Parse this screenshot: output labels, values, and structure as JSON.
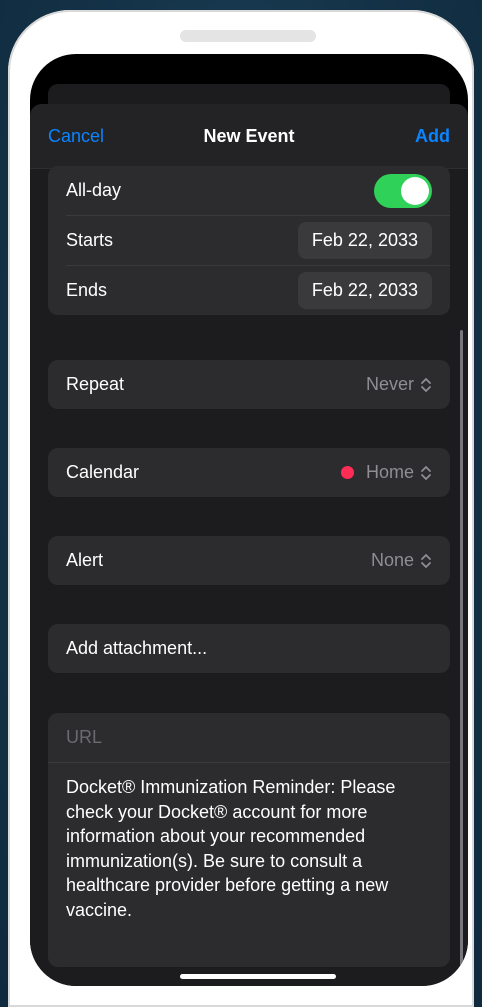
{
  "nav": {
    "cancel": "Cancel",
    "title": "New Event",
    "add": "Add"
  },
  "dates": {
    "allday_label": "All-day",
    "allday_on": true,
    "starts_label": "Starts",
    "starts_value": "Feb 22, 2033",
    "ends_label": "Ends",
    "ends_value": "Feb 22, 2033"
  },
  "repeat": {
    "label": "Repeat",
    "value": "Never"
  },
  "calendar": {
    "label": "Calendar",
    "value": "Home",
    "color": "#ff2d55"
  },
  "alert": {
    "label": "Alert",
    "value": "None"
  },
  "attachment": {
    "label": "Add attachment..."
  },
  "url": {
    "placeholder": "URL"
  },
  "notes": {
    "text": "Docket® Immunization Reminder: Please check your Docket® account for more information about your recommended immunization(s). Be sure to consult a healthcare provider before getting a new vaccine."
  },
  "colors": {
    "accent": "#0a84ff",
    "toggle_on": "#30d158"
  }
}
